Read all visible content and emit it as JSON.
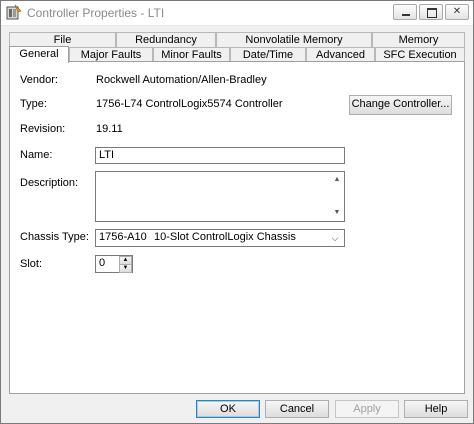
{
  "window": {
    "title": "Controller Properties - LTI"
  },
  "tabs_row1": [
    "File",
    "Redundancy",
    "Nonvolatile Memory",
    "Memory"
  ],
  "tabs_row2": [
    "General",
    "Major Faults",
    "Minor Faults",
    "Date/Time",
    "Advanced",
    "SFC Execution"
  ],
  "active_tab": "General",
  "general": {
    "vendor_label": "Vendor:",
    "vendor_value": "Rockwell Automation/Allen-Bradley",
    "type_label": "Type:",
    "type_value": "1756-L74 ControlLogix5574 Controller",
    "change_controller_label": "Change Controller...",
    "revision_label": "Revision:",
    "revision_value": "19.11",
    "name_label": "Name:",
    "name_value": "LTI",
    "description_label": "Description:",
    "description_value": "",
    "chassis_label": "Chassis Type:",
    "chassis_code": "1756-A10",
    "chassis_desc": "10-Slot ControlLogix Chassis",
    "slot_label": "Slot:",
    "slot_value": "0"
  },
  "footer": {
    "ok": "OK",
    "cancel": "Cancel",
    "apply": "Apply",
    "help": "Help"
  }
}
